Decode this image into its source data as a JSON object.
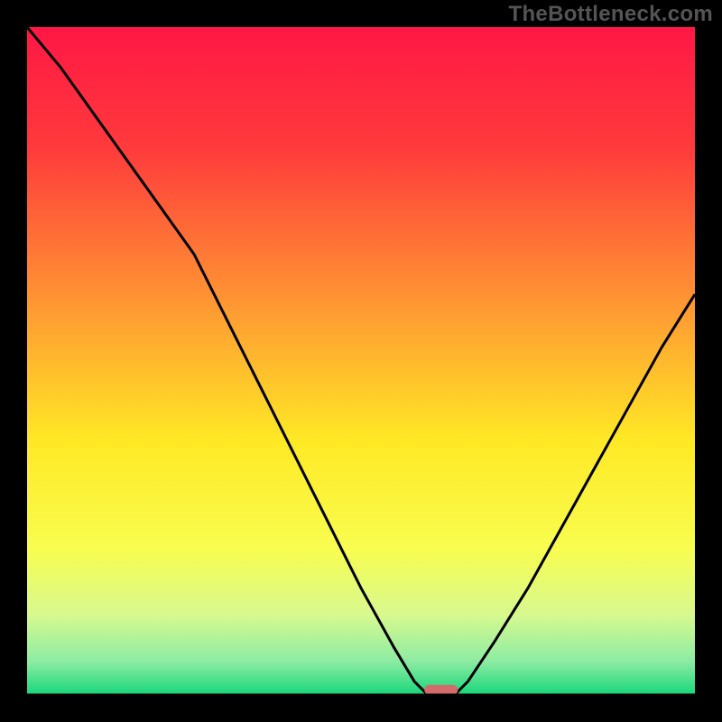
{
  "watermark": "TheBottleneck.com",
  "chart_data": {
    "type": "line",
    "title": "",
    "xlabel": "",
    "ylabel": "",
    "xlim": [
      0,
      100
    ],
    "ylim": [
      0,
      100
    ],
    "grid": false,
    "background_gradient": {
      "stops": [
        {
          "offset": 0,
          "color": "#ff1745"
        },
        {
          "offset": 18,
          "color": "#ff3a3c"
        },
        {
          "offset": 45,
          "color": "#ffa531"
        },
        {
          "offset": 62,
          "color": "#ffe925"
        },
        {
          "offset": 78,
          "color": "#f8fd4f"
        },
        {
          "offset": 88,
          "color": "#d8f98f"
        },
        {
          "offset": 95,
          "color": "#8ceca3"
        },
        {
          "offset": 100,
          "color": "#17d67a"
        }
      ]
    },
    "series": [
      {
        "name": "bottleneck-curve",
        "color": "#000000",
        "x": [
          0,
          5,
          10,
          15,
          20,
          25,
          30,
          35,
          40,
          45,
          50,
          55,
          58,
          60,
          62,
          64,
          66,
          70,
          75,
          80,
          85,
          90,
          95,
          100
        ],
        "y": [
          100,
          94,
          87,
          80,
          73,
          66,
          56,
          46,
          36,
          26,
          16,
          7,
          2,
          0,
          0,
          0,
          2,
          8,
          16,
          25,
          34,
          43,
          52,
          60
        ]
      }
    ],
    "marker": {
      "name": "optimal-point",
      "shape": "capsule",
      "x_center": 62,
      "y": 0,
      "width": 5,
      "height": 1.5,
      "color": "#d46a6a"
    }
  }
}
